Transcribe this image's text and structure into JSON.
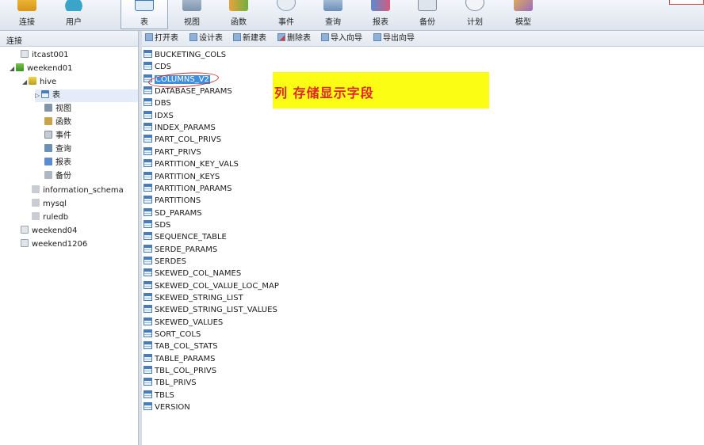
{
  "toolbar": {
    "buttons": [
      {
        "label": "连接",
        "icon": "connection-icon"
      },
      {
        "label": "用户",
        "icon": "user-icon"
      },
      {
        "label": "表",
        "icon": "table-icon",
        "active": true
      },
      {
        "label": "视图",
        "icon": "view-icon"
      },
      {
        "label": "函数",
        "icon": "function-icon"
      },
      {
        "label": "事件",
        "icon": "event-icon"
      },
      {
        "label": "查询",
        "icon": "query-icon"
      },
      {
        "label": "报表",
        "icon": "report-icon"
      },
      {
        "label": "备份",
        "icon": "backup-icon"
      },
      {
        "label": "计划",
        "icon": "schedule-icon"
      },
      {
        "label": "模型",
        "icon": "model-icon"
      }
    ]
  },
  "left_pane": {
    "header": "连接",
    "tree": [
      {
        "label": "itcast001"
      },
      {
        "label": "weekend01"
      },
      {
        "label": "hive"
      },
      {
        "label": "表"
      },
      {
        "label": "视图"
      },
      {
        "label": "函数"
      },
      {
        "label": "事件"
      },
      {
        "label": "查询"
      },
      {
        "label": "报表"
      },
      {
        "label": "备份"
      },
      {
        "label": "information_schema"
      },
      {
        "label": "mysql"
      },
      {
        "label": "ruledb"
      },
      {
        "label": "weekend04"
      },
      {
        "label": "weekend1206"
      }
    ]
  },
  "object_toolbar": {
    "buttons": [
      {
        "label": "打开表"
      },
      {
        "label": "设计表"
      },
      {
        "label": "新建表"
      },
      {
        "label": "删除表"
      },
      {
        "label": "导入向导"
      },
      {
        "label": "导出向导"
      }
    ]
  },
  "tables": [
    "BUCKETING_COLS",
    "CDS",
    "COLUMNS_V2",
    "DATABASE_PARAMS",
    "DBS",
    "IDXS",
    "INDEX_PARAMS",
    "PART_COL_PRIVS",
    "PART_PRIVS",
    "PARTITION_KEY_VALS",
    "PARTITION_KEYS",
    "PARTITION_PARAMS",
    "PARTITIONS",
    "SD_PARAMS",
    "SDS",
    "SEQUENCE_TABLE",
    "SERDE_PARAMS",
    "SERDES",
    "SKEWED_COL_NAMES",
    "SKEWED_COL_VALUE_LOC_MAP",
    "SKEWED_STRING_LIST",
    "SKEWED_STRING_LIST_VALUES",
    "SKEWED_VALUES",
    "SORT_COLS",
    "TAB_COL_STATS",
    "TABLE_PARAMS",
    "TBL_COL_PRIVS",
    "TBL_PRIVS",
    "TBLS",
    "VERSION"
  ],
  "selected_table": "COLUMNS_V2",
  "note": {
    "text": "列  存储显示字段"
  },
  "colors": {
    "note_bg": "#fbfd14",
    "note_text": "#e0262a",
    "selection": "#3d8ee0",
    "annotation": "#d0282b"
  }
}
